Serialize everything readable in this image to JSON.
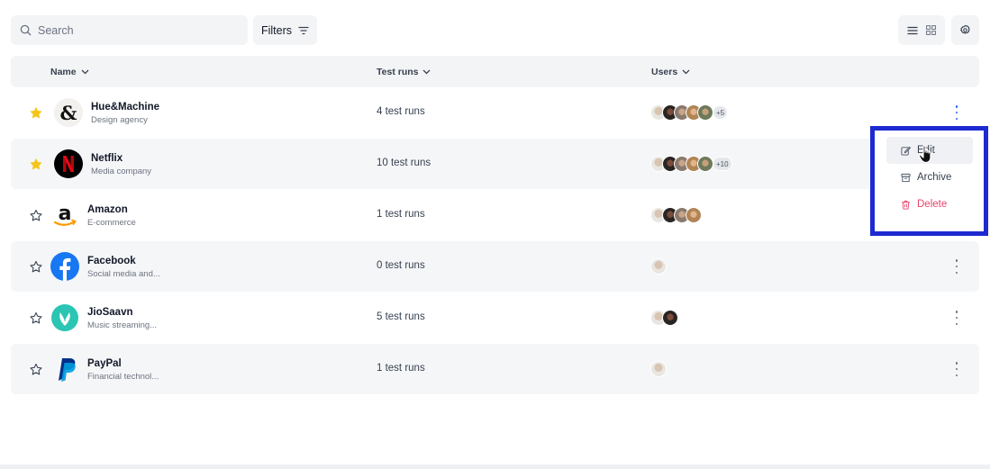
{
  "toolbar": {
    "search_placeholder": "Search",
    "filters_label": "Filters"
  },
  "columns": {
    "name": "Name",
    "test_runs": "Test runs",
    "users": "Users"
  },
  "rows": [
    {
      "name": "Hue&Machine",
      "subtitle": "Design agency",
      "runs": "4 test runs",
      "starred": true,
      "logo": "hue-machine-logo",
      "avatars": 5,
      "more": "+5"
    },
    {
      "name": "Netflix",
      "subtitle": "Media company",
      "runs": "10 test runs",
      "starred": true,
      "logo": "netflix-logo",
      "avatars": 5,
      "more": "+10"
    },
    {
      "name": "Amazon",
      "subtitle": "E-commerce",
      "runs": "1 test runs",
      "starred": false,
      "logo": "amazon-logo",
      "avatars": 4,
      "more": ""
    },
    {
      "name": "Facebook",
      "subtitle": "Social media and...",
      "runs": "0 test runs",
      "starred": false,
      "logo": "facebook-logo",
      "avatars": 1,
      "more": ""
    },
    {
      "name": "JioSaavn",
      "subtitle": "Music streaming...",
      "runs": "5 test runs",
      "starred": false,
      "logo": "jiosaavn-logo",
      "avatars": 2,
      "more": ""
    },
    {
      "name": "PayPal",
      "subtitle": "Financial technol...",
      "runs": "1 test runs",
      "starred": false,
      "logo": "paypal-logo",
      "avatars": 1,
      "more": ""
    }
  ],
  "context_menu": {
    "edit": "Edit",
    "archive": "Archive",
    "delete": "Delete"
  },
  "colors": {
    "star": "#f5c518",
    "accent": "#2563eb",
    "danger": "#e8436b",
    "highlight_border": "#1e2ad1"
  }
}
